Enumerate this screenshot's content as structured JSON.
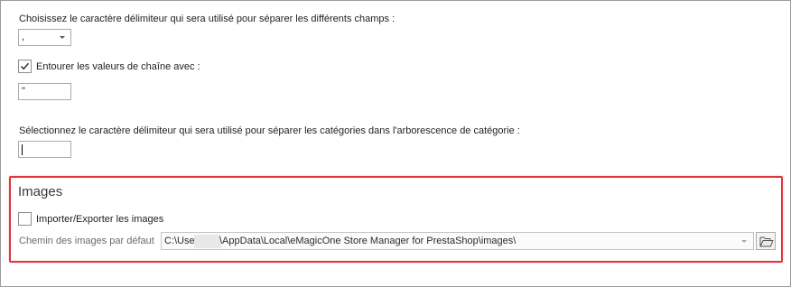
{
  "delimiter_section": {
    "field_label": "Choisissez le caractère délimiteur qui sera utilisé pour séparer les différents champs :",
    "field_delimiter_value": ",",
    "enclose_checkbox_label": "Entourer les valeurs de chaîne avec :",
    "enclose_checked": true,
    "enclose_value": "\"",
    "category_label": "Sélectionnez le caractère délimiteur qui sera utilisé pour séparer les catégories dans l'arborescence de catégorie :",
    "category_value": ""
  },
  "images_section": {
    "title": "Images",
    "import_export_label": "Importer/Exporter les images",
    "import_export_checked": false,
    "path_label": "Chemin des images par défaut",
    "path_prefix": "C:\\Users\\",
    "path_suffix": "\\AppData\\Local\\eMagicOne Store Manager for PrestaShop\\images\\"
  },
  "icons": {
    "dropdown": "chevron-down-icon",
    "check": "checkmark-icon",
    "browse": "folder-open-icon"
  },
  "colors": {
    "highlight_border": "#e0353d",
    "window_border": "#9b9b9b"
  }
}
